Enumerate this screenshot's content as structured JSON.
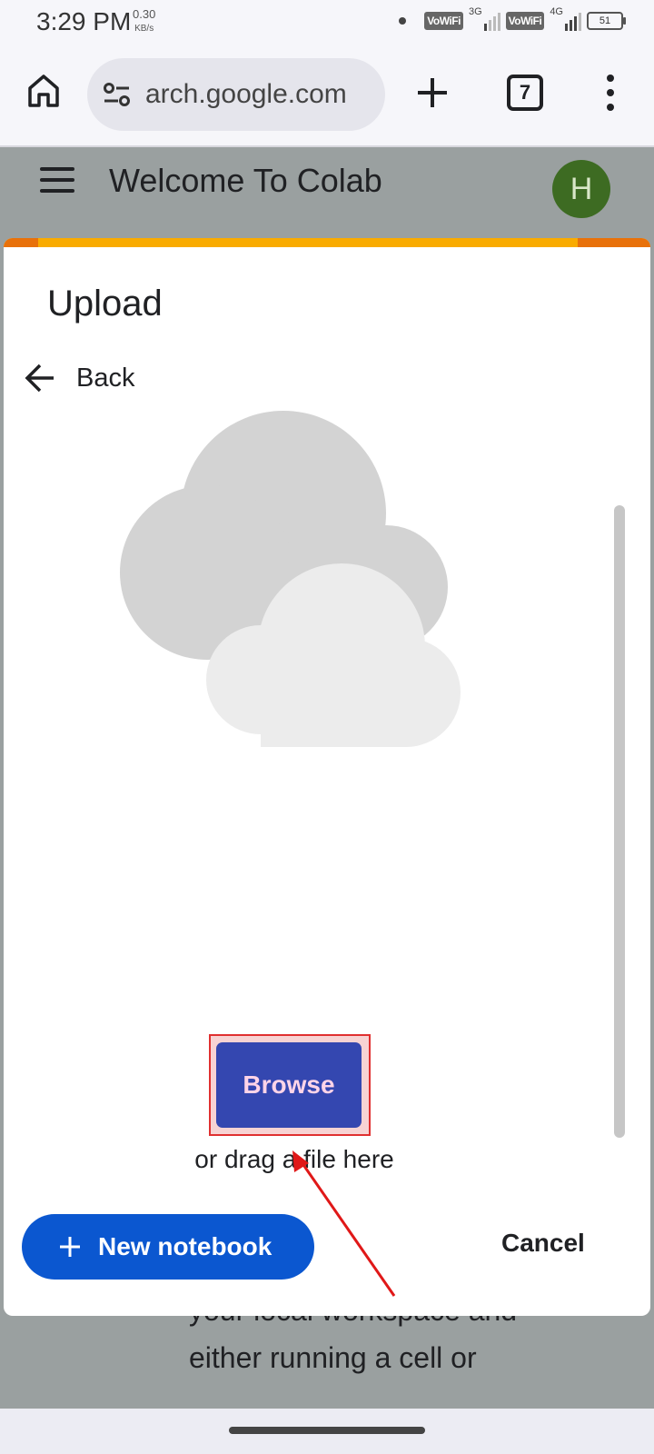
{
  "status_bar": {
    "time": "3:29 PM",
    "speed_value": "0.30",
    "speed_unit": "KB/s",
    "sim1_label": "VoWiFi",
    "sim1_net": "3G",
    "sim2_label": "VoWiFi",
    "sim2_net": "4G",
    "battery": "51"
  },
  "browser": {
    "url": "arch.google.com",
    "tab_count": "7"
  },
  "colab": {
    "title": "Welcome To Colab",
    "avatar_letter": "H",
    "avatar_color": "#3d6b22",
    "background_text_line1": "your local workspace and",
    "background_text_line2": "either running a cell or"
  },
  "dialog": {
    "title": "Upload",
    "back_label": "Back",
    "browse_label": "Browse",
    "drag_text": "or drag a file here",
    "new_notebook_label": "New notebook",
    "cancel_label": "Cancel",
    "accent_color": "#f9ab00",
    "button_color": "#0b57d0"
  }
}
